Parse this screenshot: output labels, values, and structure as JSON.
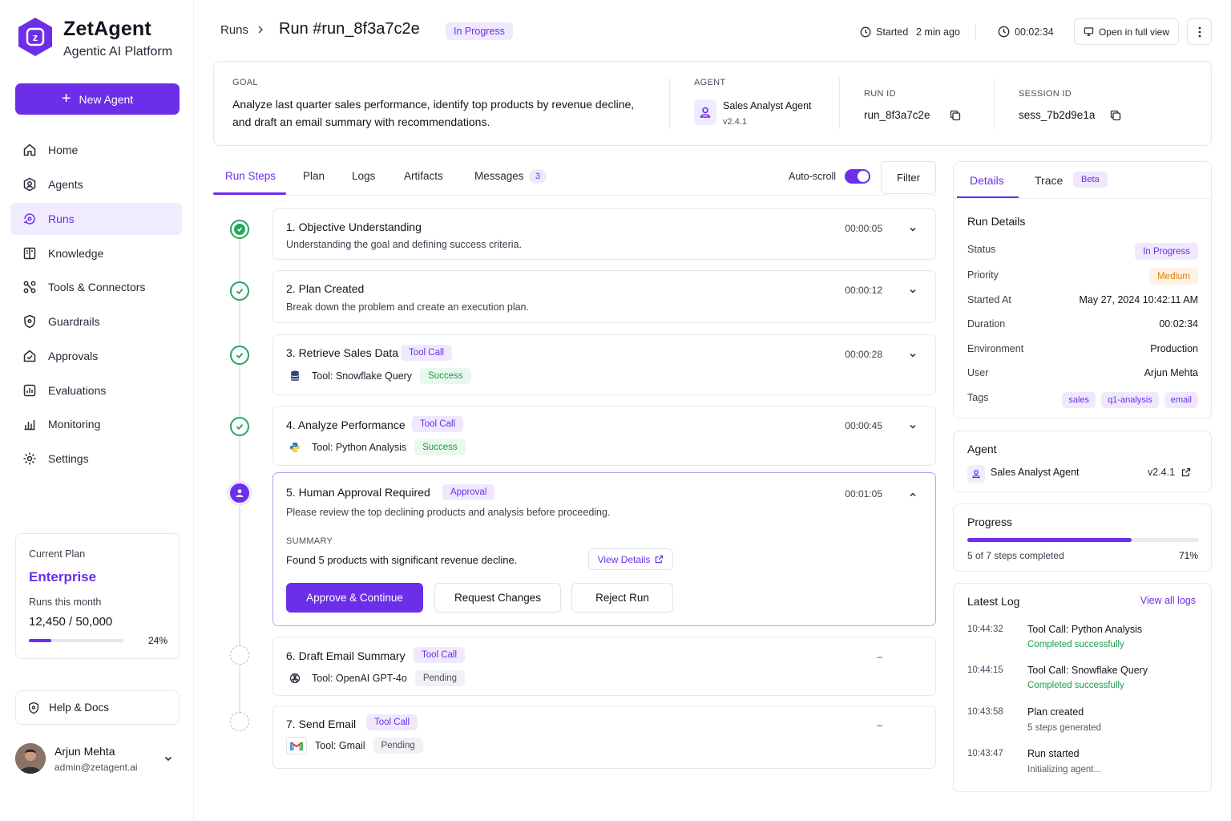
{
  "brand": {
    "name": "ZetAgent",
    "subtitle": "Agentic AI Platform",
    "logo_letter": "z"
  },
  "sidebar": {
    "new_agent_label": "New Agent",
    "items": [
      {
        "label": "Home",
        "icon": "home-icon"
      },
      {
        "label": "Agents",
        "icon": "agents-icon"
      },
      {
        "label": "Runs",
        "icon": "runs-icon",
        "active": true
      },
      {
        "label": "Knowledge",
        "icon": "book-icon"
      },
      {
        "label": "Tools & Connectors",
        "icon": "tools-icon"
      },
      {
        "label": "Guardrails",
        "icon": "shield-icon"
      },
      {
        "label": "Approvals",
        "icon": "approvals-icon"
      },
      {
        "label": "Evaluations",
        "icon": "evaluations-icon"
      },
      {
        "label": "Monitoring",
        "icon": "monitoring-icon"
      },
      {
        "label": "Settings",
        "icon": "gear-icon"
      }
    ],
    "plan": {
      "label": "Current Plan",
      "name": "Enterprise",
      "runs_label": "Runs this month",
      "runs_value": "12,450 / 50,000",
      "percent_label": "24%",
      "percent": 0.24
    },
    "help_label": "Help & Docs",
    "user": {
      "name": "Arjun Mehta",
      "email": "admin@zetagent.ai"
    }
  },
  "header": {
    "breadcrumb_root": "Runs",
    "run_title": "Run #run_8f3a7c2e",
    "status": "In Progress",
    "started_label": "Started",
    "started_value": "2 min ago",
    "elapsed": "00:02:34",
    "open_full_view": "Open in full view"
  },
  "goal": {
    "label": "GOAL",
    "text_line1": "Analyze last quarter sales performance, identify top products by revenue decline,",
    "text_line2": "and draft an email summary with recommendations.",
    "agent_label": "AGENT",
    "agent_name": "Sales Analyst Agent",
    "agent_version": "v2.4.1",
    "run_id_label": "RUN ID",
    "run_id": "run_8f3a7c2e",
    "session_id_label": "SESSION ID",
    "session_id": "sess_7b2d9e1a"
  },
  "tabs": [
    {
      "label": "Run Steps",
      "active": true
    },
    {
      "label": "Plan"
    },
    {
      "label": "Logs"
    },
    {
      "label": "Artifacts"
    },
    {
      "label": "Messages",
      "badge": "3"
    }
  ],
  "toolbar": {
    "autoscroll_label": "Auto-scroll",
    "autoscroll_on": true,
    "filter_label": "Filter"
  },
  "steps": [
    {
      "title": "1.  Objective Understanding",
      "desc": "Understanding the goal and defining success criteria.",
      "time": "00:00:05",
      "state": "done"
    },
    {
      "title": "2.  Plan Created",
      "desc": "Break down the problem and create an execution plan.",
      "time": "00:00:12",
      "state": "done"
    },
    {
      "title": "3. Retrieve Sales Data",
      "tag": "Tool Call",
      "tool": "Tool: Snowflake Query",
      "tool_status": "Success",
      "time": "00:00:28",
      "state": "done"
    },
    {
      "title": "4.  Analyze Performance",
      "tag": "Tool Call",
      "tool": "Tool: Python Analysis",
      "tool_status": "Success",
      "time": "00:00:45",
      "state": "done"
    },
    {
      "title": "5.  Human Approval Required",
      "tag": "Approval",
      "desc": "Please review the top declining products and analysis before proceeding.",
      "time": "00:01:05",
      "state": "active",
      "summary_label": "SUMMARY",
      "summary_text": "Found 5 products with significant revenue decline.",
      "view_details": "View Details",
      "approve": "Approve & Continue",
      "request_changes": "Request Changes",
      "reject": "Reject Run"
    },
    {
      "title": "6.  Draft Email Summary",
      "tag": "Tool Call",
      "tool": "Tool: OpenAI GPT-4o",
      "tool_status": "Pending",
      "time": "–",
      "state": "pending"
    },
    {
      "title": "7.  Send Email",
      "tag": "Tool Call",
      "tool": "Tool: Gmail",
      "tool_status": "Pending",
      "time": "–",
      "state": "pending"
    }
  ],
  "right_panel": {
    "tabs": [
      {
        "label": "Details",
        "active": true
      },
      {
        "label": "Trace",
        "badge": "Beta"
      }
    ],
    "run_details_title": "Run Details",
    "details": {
      "status_label": "Status",
      "status": "In Progress",
      "priority_label": "Priority",
      "priority": "Medium",
      "started_label": "Started At",
      "started": "May 27, 2024 10:42:11 AM",
      "duration_label": "Duration",
      "duration": "00:02:34",
      "env_label": "Environment",
      "env": "Production",
      "user_label": "User",
      "user": "Arjun Mehta",
      "tags_label": "Tags",
      "tags": [
        "sales",
        "q1-analysis",
        "email"
      ]
    },
    "agent_title": "Agent",
    "agent_name": "Sales Analyst Agent",
    "agent_version": "v2.4.1",
    "progress_title": "Progress",
    "progress_text": "5 of 7 steps completed",
    "progress_percent_label": "71%",
    "progress_fraction": 0.71,
    "latest_log_title": "Latest Log",
    "view_all_logs": "View all logs",
    "logs": [
      {
        "time": "10:44:32",
        "title": "Tool Call: Python Analysis",
        "sub": "Completed successfully",
        "success": true
      },
      {
        "time": "10:44:15",
        "title": "Tool Call: Snowflake Query",
        "sub": "Completed successfully",
        "success": true
      },
      {
        "time": "10:43:58",
        "title": "Plan created",
        "sub": "5 steps generated",
        "success": false
      },
      {
        "time": "10:43:47",
        "title": "Run started",
        "sub": "Initializing agent...",
        "success": false
      }
    ]
  },
  "colors": {
    "accent": "#6d2eea",
    "success": "#22a85a",
    "warning": "#d48410"
  }
}
